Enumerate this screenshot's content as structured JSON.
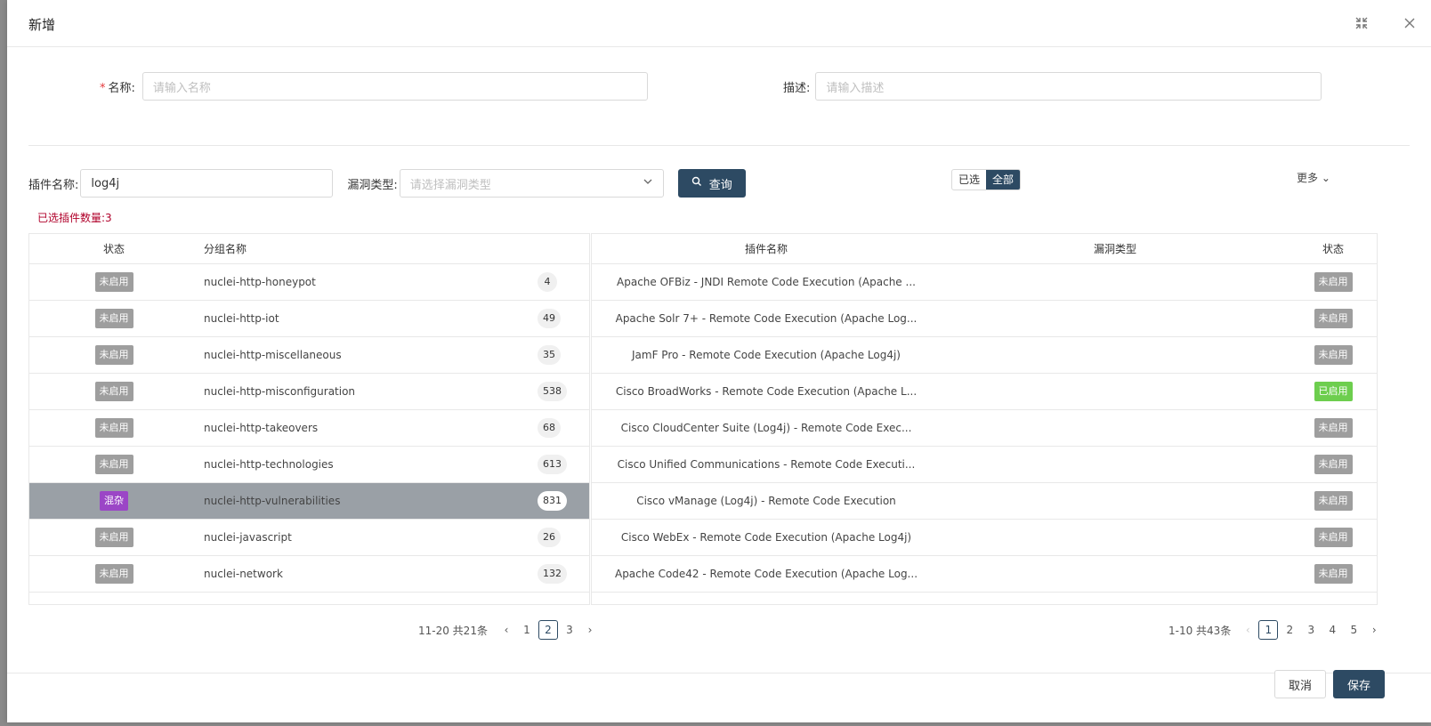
{
  "modal": {
    "title": "新增"
  },
  "form": {
    "name_label": "名称",
    "name_required": "*",
    "name_colon": ":",
    "name_placeholder": "请输入名称",
    "desc_label": "描述",
    "desc_colon": ":",
    "desc_placeholder": "请输入描述"
  },
  "search": {
    "plugin_label": "插件名称:",
    "plugin_value": "log4j",
    "vuln_label": "漏洞类型:",
    "vuln_placeholder": "请选择漏洞类型",
    "query_label": "查询",
    "seg_selected": "已选",
    "seg_all": "全部",
    "more_label": "更多"
  },
  "selected_count": "已选插件数量:3",
  "left_table": {
    "headers": {
      "status": "状态",
      "group": "分组名称"
    },
    "rows": [
      {
        "status": "未启用",
        "name": "nuclei-http-honeypot",
        "count": "4"
      },
      {
        "status": "未启用",
        "name": "nuclei-http-iot",
        "count": "49"
      },
      {
        "status": "未启用",
        "name": "nuclei-http-miscellaneous",
        "count": "35"
      },
      {
        "status": "未启用",
        "name": "nuclei-http-misconfiguration",
        "count": "538"
      },
      {
        "status": "未启用",
        "name": "nuclei-http-takeovers",
        "count": "68"
      },
      {
        "status": "未启用",
        "name": "nuclei-http-technologies",
        "count": "613"
      },
      {
        "status": "混杂",
        "name": "nuclei-http-vulnerabilities",
        "count": "831"
      },
      {
        "status": "未启用",
        "name": "nuclei-javascript",
        "count": "26"
      },
      {
        "status": "未启用",
        "name": "nuclei-network",
        "count": "132"
      }
    ],
    "pagination": {
      "summary": "11-20 共21条",
      "pages": [
        "1",
        "2",
        "3"
      ]
    }
  },
  "right_table": {
    "headers": {
      "plugin": "插件名称",
      "vuln": "漏洞类型",
      "status": "状态"
    },
    "rows": [
      {
        "name": "Apache OFBiz - JNDI Remote Code Execution (Apache ...",
        "status": "未启用"
      },
      {
        "name": "Apache Solr 7+ - Remote Code Execution (Apache Log...",
        "status": "未启用"
      },
      {
        "name": "JamF Pro - Remote Code Execution (Apache Log4j)",
        "status": "未启用"
      },
      {
        "name": "Cisco BroadWorks - Remote Code Execution (Apache L...",
        "status": "已启用"
      },
      {
        "name": "Cisco CloudCenter Suite (Log4j) - Remote Code Exec...",
        "status": "未启用"
      },
      {
        "name": "Cisco Unified Communications - Remote Code Executi...",
        "status": "未启用"
      },
      {
        "name": "Cisco vManage (Log4j) - Remote Code Execution",
        "status": "未启用"
      },
      {
        "name": "Cisco WebEx - Remote Code Execution (Apache Log4j)",
        "status": "未启用"
      },
      {
        "name": "Apache Code42 - Remote Code Execution (Apache Log...",
        "status": "未启用"
      }
    ],
    "pagination": {
      "summary": "1-10 共43条",
      "pages": [
        "1",
        "2",
        "3",
        "4",
        "5"
      ]
    }
  },
  "footer": {
    "cancel_label": "取消",
    "save_label": "保存"
  },
  "colors": {
    "primary": "#2d4a63",
    "disabled_tag": "#9e9e9e",
    "enabled_tag": "#6dce4e",
    "mixed_tag": "#9b46c6",
    "count_text": "#b0002a"
  }
}
